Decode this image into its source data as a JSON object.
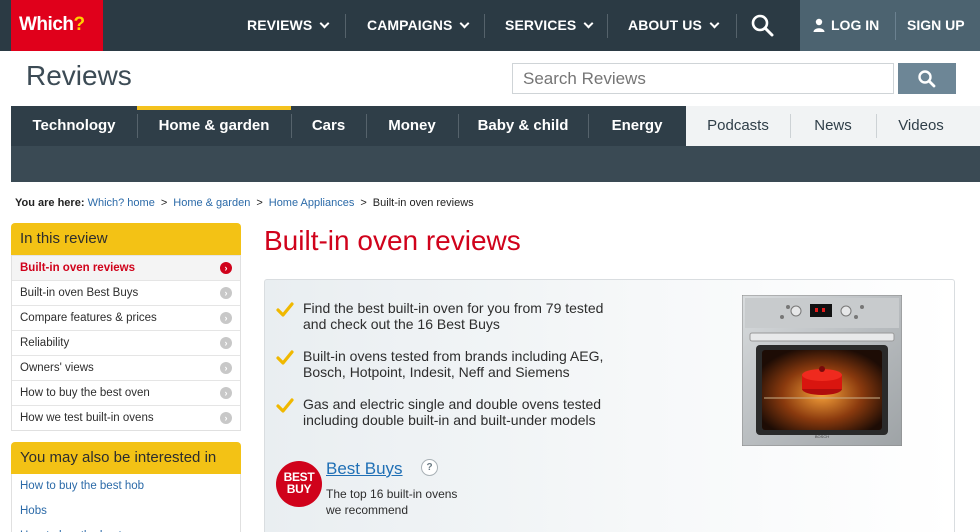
{
  "header": {
    "logo_text": "Which",
    "logo_q": "?",
    "nav": [
      {
        "label": "REVIEWS"
      },
      {
        "label": "CAMPAIGNS"
      },
      {
        "label": "SERVICES"
      },
      {
        "label": "ABOUT US"
      }
    ],
    "login": "LOG IN",
    "signup": "SIGN UP"
  },
  "section": {
    "title": "Reviews",
    "search_placeholder": "Search Reviews"
  },
  "categories": [
    {
      "label": "Technology"
    },
    {
      "label": "Home & garden"
    },
    {
      "label": "Cars"
    },
    {
      "label": "Money"
    },
    {
      "label": "Baby & child"
    },
    {
      "label": "Energy"
    },
    {
      "label": "Podcasts"
    },
    {
      "label": "News"
    },
    {
      "label": "Videos"
    }
  ],
  "breadcrumb": {
    "prefix": "You are here:",
    "links": [
      "Which? home",
      "Home & garden",
      "Home Appliances"
    ],
    "current": "Built-in oven reviews"
  },
  "sidebar": {
    "in_review_title": "In this review",
    "in_review_items": [
      {
        "label": "Built-in oven reviews"
      },
      {
        "label": "Built-in oven Best Buys"
      },
      {
        "label": "Compare features & prices"
      },
      {
        "label": "Reliability"
      },
      {
        "label": "Owners' views"
      },
      {
        "label": "How to buy the best oven"
      },
      {
        "label": "How we test built-in ovens"
      }
    ],
    "interested_title": "You may also be interested in",
    "interested_items": [
      {
        "label": "How to buy the best hob"
      },
      {
        "label": "Hobs"
      },
      {
        "label": "How to buy the best"
      }
    ]
  },
  "main": {
    "title": "Built-in oven reviews",
    "bullets": [
      {
        "line1": "Find the best built-in oven for you from 79 tested",
        "line2": "and check out the 16 Best Buys"
      },
      {
        "line1": "Built-in ovens tested from brands including AEG,",
        "line2": "Bosch, Hotpoint, Indesit, Neff and Siemens"
      },
      {
        "line1": "Gas and electric single and double ovens tested",
        "line2": "including double built-in and built-under models"
      }
    ],
    "best_buys": {
      "badge_line1": "BEST",
      "badge_line2": "BUY",
      "title": "Best Buys",
      "help": "?",
      "desc_line1": "The top 16 built-in ovens",
      "desc_line2": "we recommend"
    }
  },
  "colors": {
    "brand_red": "#e0001b",
    "nav_dark": "#2b3a44",
    "accent_yellow": "#f3c215",
    "link_blue": "#2b6aa8"
  }
}
